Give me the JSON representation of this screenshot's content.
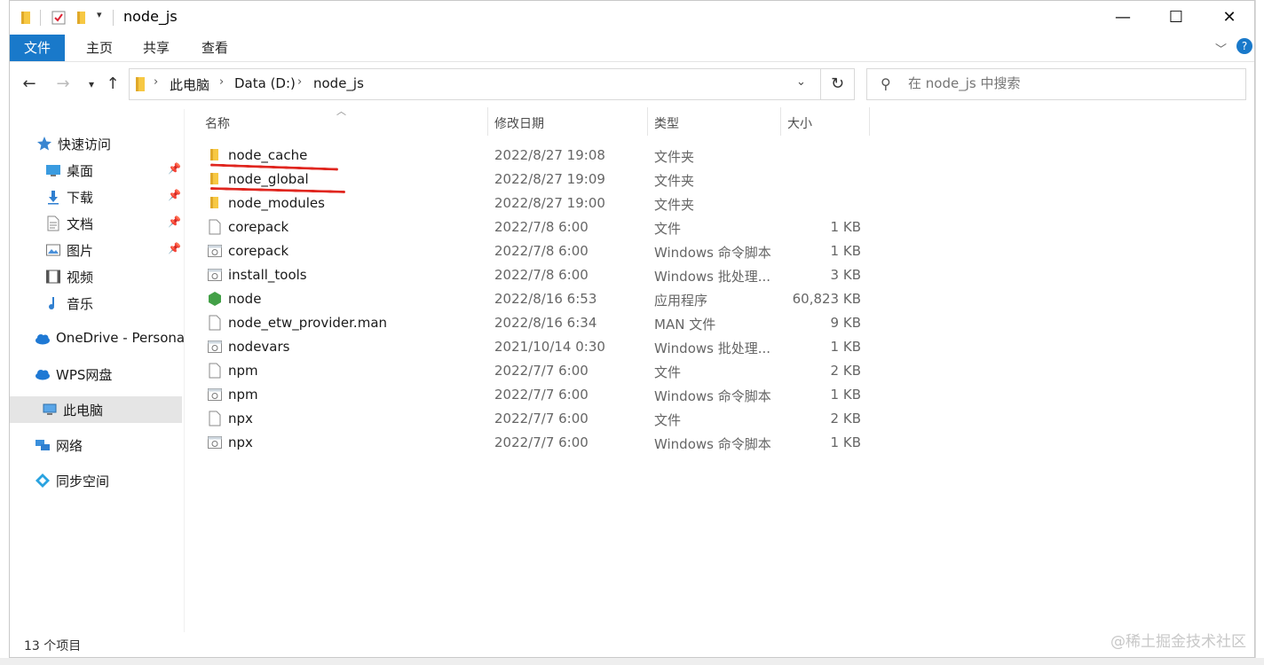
{
  "window": {
    "title": "node_js",
    "controls": {
      "minimize": "—",
      "maximize": "☐",
      "close": "✕"
    }
  },
  "ribbon": {
    "tabs": [
      "文件",
      "主页",
      "共享",
      "查看"
    ]
  },
  "address": {
    "crumbs": [
      "此电脑",
      "Data (D:)",
      "node_js"
    ],
    "search_placeholder": "在 node_js 中搜索"
  },
  "nav": {
    "items": [
      {
        "label": "快速访问",
        "icon": "star-icon",
        "pinned": false
      },
      {
        "label": "桌面",
        "icon": "desktop-icon",
        "pinned": true
      },
      {
        "label": "下载",
        "icon": "download-icon",
        "pinned": true
      },
      {
        "label": "文档",
        "icon": "document-icon",
        "pinned": true
      },
      {
        "label": "图片",
        "icon": "pictures-icon",
        "pinned": true
      },
      {
        "label": "视频",
        "icon": "video-icon",
        "pinned": false
      },
      {
        "label": "音乐",
        "icon": "music-icon",
        "pinned": false
      },
      {
        "label": "OneDrive - Persona",
        "icon": "cloud-icon",
        "pinned": false
      },
      {
        "label": "WPS网盘",
        "icon": "cloud-icon",
        "pinned": false
      },
      {
        "label": "此电脑",
        "icon": "computer-icon",
        "pinned": false
      },
      {
        "label": "网络",
        "icon": "network-icon",
        "pinned": false
      },
      {
        "label": "同步空间",
        "icon": "sync-icon",
        "pinned": false
      }
    ]
  },
  "columns": {
    "name": "名称",
    "date": "修改日期",
    "type": "类型",
    "size": "大小"
  },
  "files": [
    {
      "name": "node_cache",
      "date": "2022/8/27 19:08",
      "type": "文件夹",
      "size": "",
      "icon": "folder-icon"
    },
    {
      "name": "node_global",
      "date": "2022/8/27 19:09",
      "type": "文件夹",
      "size": "",
      "icon": "folder-icon"
    },
    {
      "name": "node_modules",
      "date": "2022/8/27 19:00",
      "type": "文件夹",
      "size": "",
      "icon": "folder-icon"
    },
    {
      "name": "corepack",
      "date": "2022/7/8 6:00",
      "type": "文件",
      "size": "1 KB",
      "icon": "file-icon"
    },
    {
      "name": "corepack",
      "date": "2022/7/8 6:00",
      "type": "Windows 命令脚本",
      "size": "1 KB",
      "icon": "script-icon"
    },
    {
      "name": "install_tools",
      "date": "2022/7/8 6:00",
      "type": "Windows 批处理...",
      "size": "3 KB",
      "icon": "script-icon"
    },
    {
      "name": "node",
      "date": "2022/8/16 6:53",
      "type": "应用程序",
      "size": "60,823 KB",
      "icon": "node-app-icon"
    },
    {
      "name": "node_etw_provider.man",
      "date": "2022/8/16 6:34",
      "type": "MAN 文件",
      "size": "9 KB",
      "icon": "file-icon"
    },
    {
      "name": "nodevars",
      "date": "2021/10/14 0:30",
      "type": "Windows 批处理...",
      "size": "1 KB",
      "icon": "script-icon"
    },
    {
      "name": "npm",
      "date": "2022/7/7 6:00",
      "type": "文件",
      "size": "2 KB",
      "icon": "file-icon"
    },
    {
      "name": "npm",
      "date": "2022/7/7 6:00",
      "type": "Windows 命令脚本",
      "size": "1 KB",
      "icon": "script-icon"
    },
    {
      "name": "npx",
      "date": "2022/7/7 6:00",
      "type": "文件",
      "size": "2 KB",
      "icon": "file-icon"
    },
    {
      "name": "npx",
      "date": "2022/7/7 6:00",
      "type": "Windows 命令脚本",
      "size": "1 KB",
      "icon": "script-icon"
    }
  ],
  "status": {
    "item_count": "13 个项目"
  },
  "watermark": "@稀土掘金技术社区",
  "colors": {
    "accent": "#1979ca",
    "folder": "#f7c843",
    "annotation": "#e0261f",
    "selected": "#e5e5e5"
  }
}
